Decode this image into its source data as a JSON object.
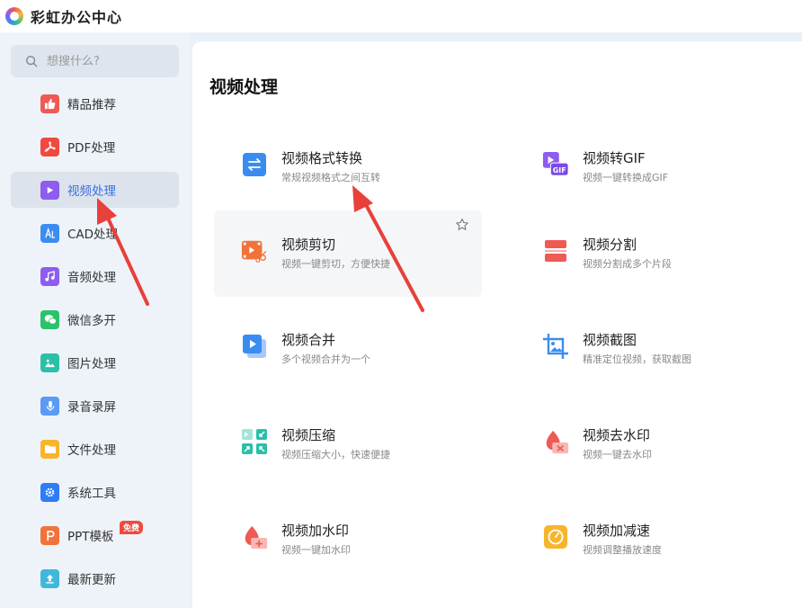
{
  "app": {
    "title": "彩虹办公中心"
  },
  "search": {
    "placeholder": "想搜什么?"
  },
  "sidebar": {
    "items": [
      {
        "label": "精品推荐",
        "icon": "thumbs-up-icon",
        "color": "#ef5a55"
      },
      {
        "label": "PDF处理",
        "icon": "pdf-icon",
        "color": "#f04a3e"
      },
      {
        "label": "视频处理",
        "icon": "play-icon",
        "color": "#8e5cf0",
        "active": true
      },
      {
        "label": "CAD处理",
        "icon": "cad-icon",
        "color": "#3b8cf0"
      },
      {
        "label": "音频处理",
        "icon": "music-note-icon",
        "color": "#8e5cf0"
      },
      {
        "label": "微信多开",
        "icon": "wechat-icon",
        "color": "#2bc26b"
      },
      {
        "label": "图片处理",
        "icon": "image-icon",
        "color": "#2bbfa8"
      },
      {
        "label": "录音录屏",
        "icon": "microphone-icon",
        "color": "#5b9af5"
      },
      {
        "label": "文件处理",
        "icon": "folder-icon",
        "color": "#f7b52c"
      },
      {
        "label": "系统工具",
        "icon": "gear-icon",
        "color": "#2e7cf6"
      },
      {
        "label": "PPT模板",
        "icon": "ppt-icon",
        "color": "#f2733a",
        "badge": "免费"
      },
      {
        "label": "最新更新",
        "icon": "upload-icon",
        "color": "#3fb8d9"
      }
    ]
  },
  "main": {
    "title": "视频处理",
    "tools": [
      {
        "title": "视频格式转换",
        "desc": "常规视频格式之间互转",
        "icon": "convert-icon",
        "color": "#3b8cf0"
      },
      {
        "title": "视频转GIF",
        "desc": "视频一键转换成GIF",
        "icon": "gif-icon",
        "color": "#8e5cf0"
      },
      {
        "title": "视频剪切",
        "desc": "视频一键剪切，方便快捷",
        "icon": "scissors-film-icon",
        "color": "#f2733a"
      },
      {
        "title": "视频分割",
        "desc": "视频分割成多个片段",
        "icon": "split-icon",
        "color": "#ef5a55"
      },
      {
        "title": "视频合并",
        "desc": "多个视频合并为一个",
        "icon": "merge-video-icon",
        "color": "#3b8cf0"
      },
      {
        "title": "视频截图",
        "desc": "精准定位视频，获取截图",
        "icon": "crop-image-icon",
        "color": "#3b8cf0"
      },
      {
        "title": "视频压缩",
        "desc": "视频压缩大小，快速便捷",
        "icon": "compress-icon",
        "color": "#2bbfa8"
      },
      {
        "title": "视频去水印",
        "desc": "视频一键去水印",
        "icon": "remove-watermark-icon",
        "color": "#ef5a55"
      },
      {
        "title": "视频加水印",
        "desc": "视频一键加水印",
        "icon": "add-watermark-icon",
        "color": "#ef5a55"
      },
      {
        "title": "视频加减速",
        "desc": "视频调整播放速度",
        "icon": "speed-icon",
        "color": "#f7b52c"
      }
    ]
  },
  "colors": {
    "accent": "#3b6fe0",
    "arrow": "#e8403a",
    "badge": "#f04a3e"
  }
}
